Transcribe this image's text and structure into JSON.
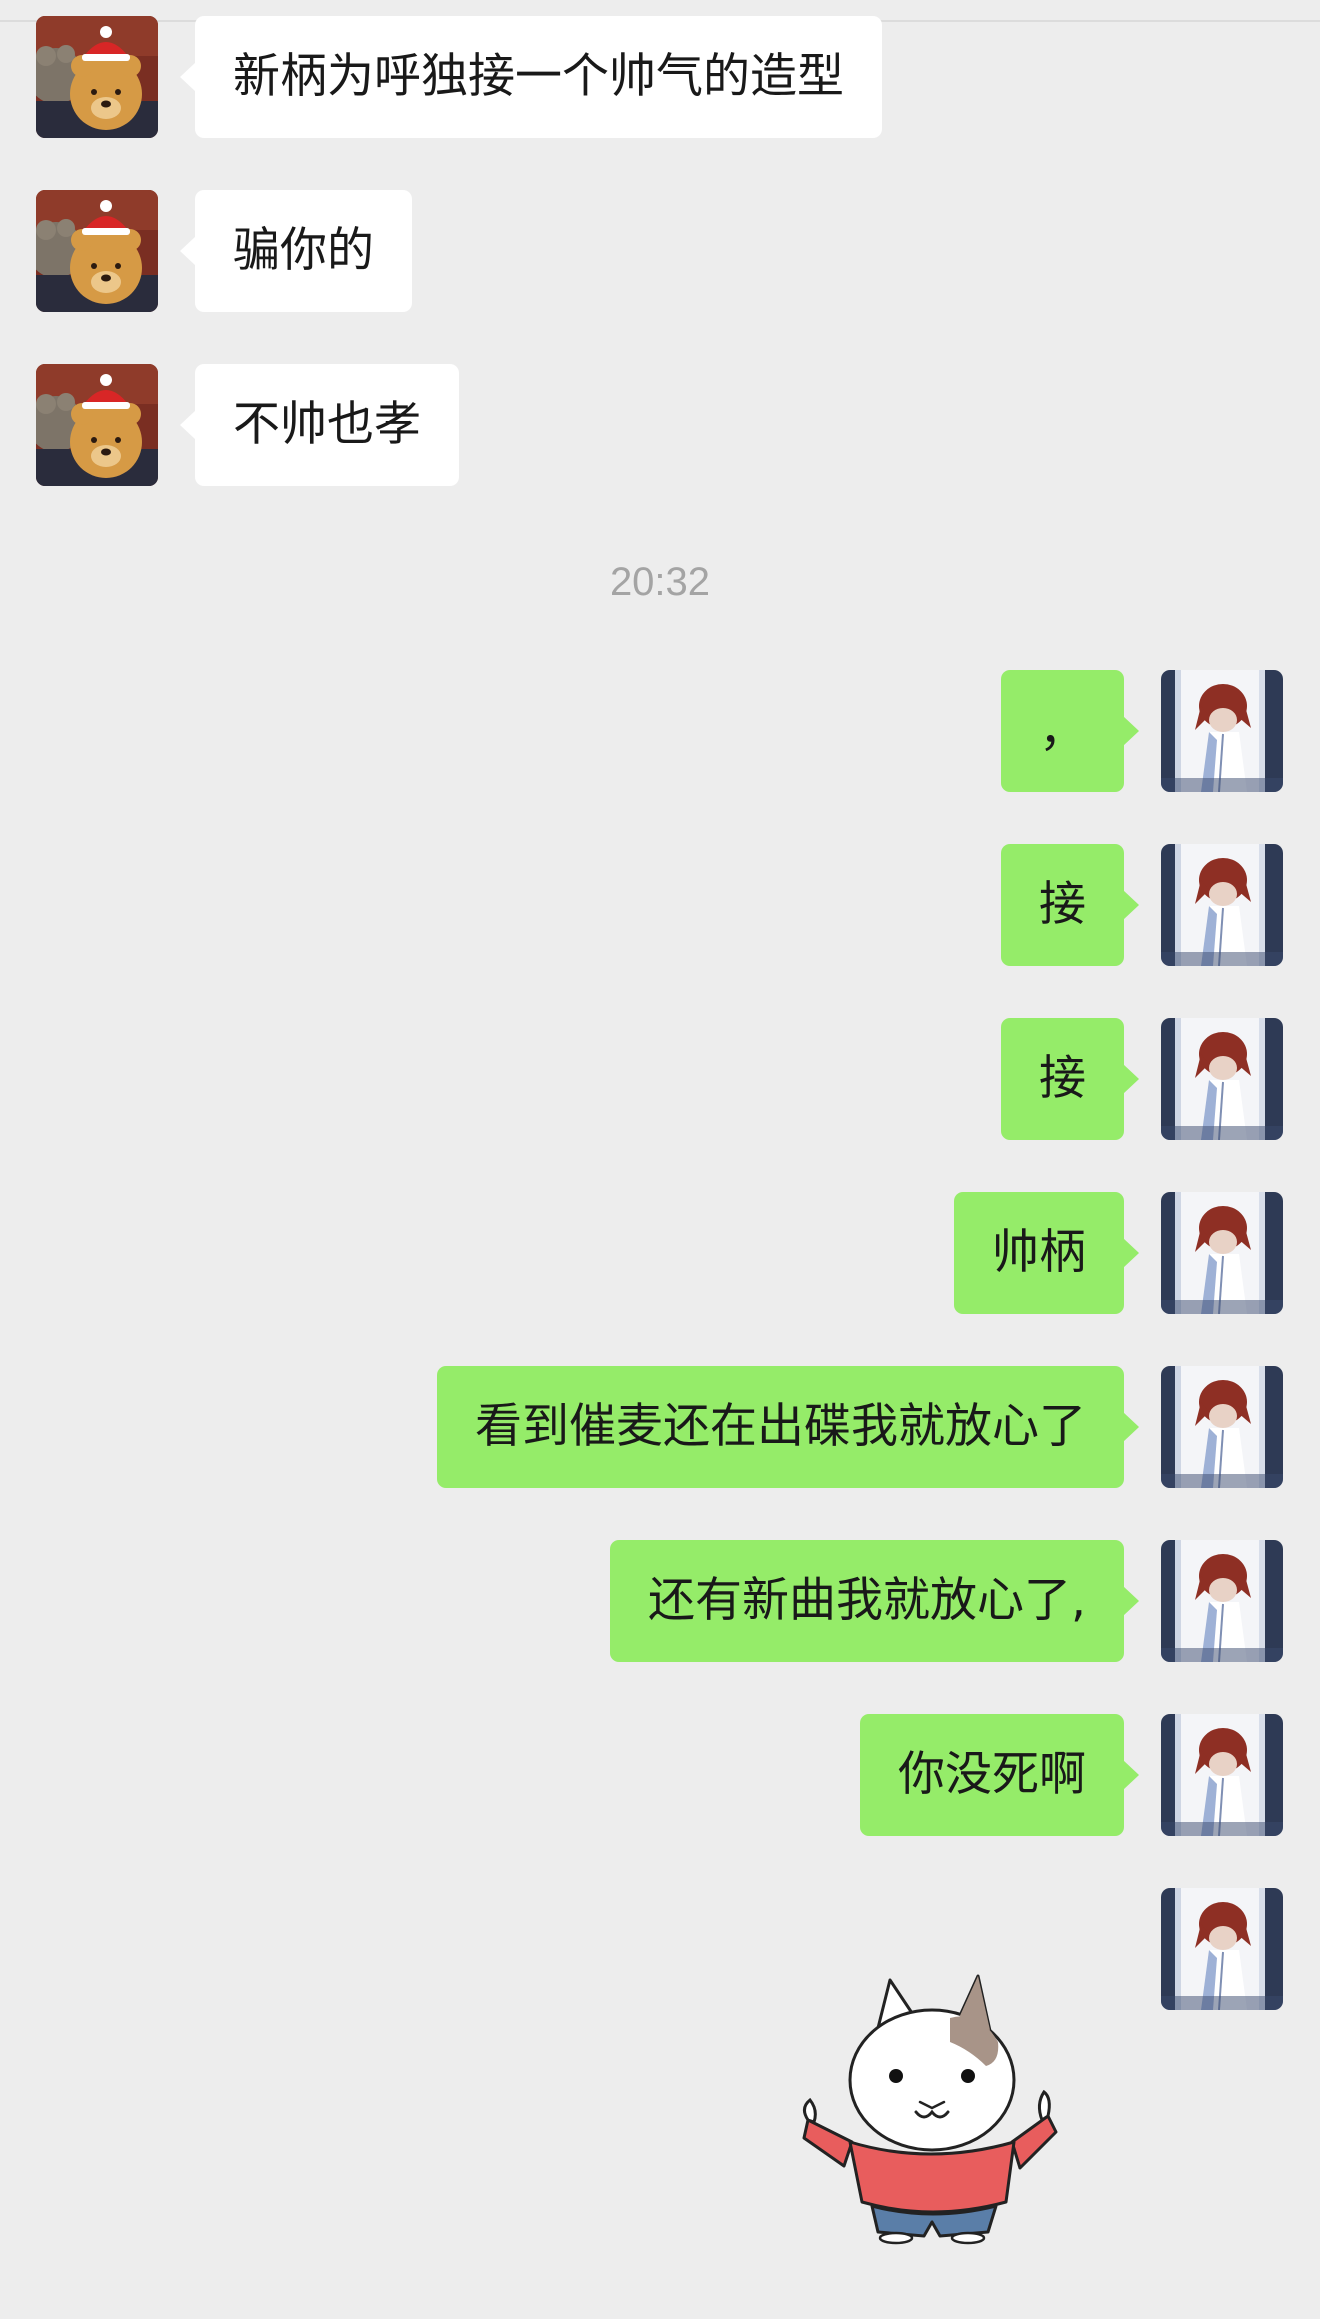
{
  "chat": {
    "received": [
      {
        "text": "新柄为呼独接一个帅气的造型",
        "avatar": "teddy-bear-avatar"
      },
      {
        "text": "骗你的",
        "avatar": "teddy-bear-avatar"
      },
      {
        "text": "不帅也孝",
        "avatar": "teddy-bear-avatar"
      }
    ],
    "timestamp": "20:32",
    "sent": [
      {
        "text": "，",
        "avatar": "anime-character-avatar"
      },
      {
        "text": "接",
        "avatar": "anime-character-avatar"
      },
      {
        "text": "接",
        "avatar": "anime-character-avatar"
      },
      {
        "text": "帅柄",
        "avatar": "anime-character-avatar"
      },
      {
        "text": "看到催麦还在出碟我就放心了",
        "avatar": "anime-character-avatar"
      },
      {
        "text": "还有新曲我就放心了,",
        "avatar": "anime-character-avatar"
      },
      {
        "text": "你没死啊",
        "avatar": "anime-character-avatar"
      }
    ],
    "sticker": "cat-sticker"
  },
  "colors": {
    "background": "#ededed",
    "received_bubble": "#ffffff",
    "sent_bubble": "#95ec69",
    "timestamp_text": "#a4a4a4"
  }
}
